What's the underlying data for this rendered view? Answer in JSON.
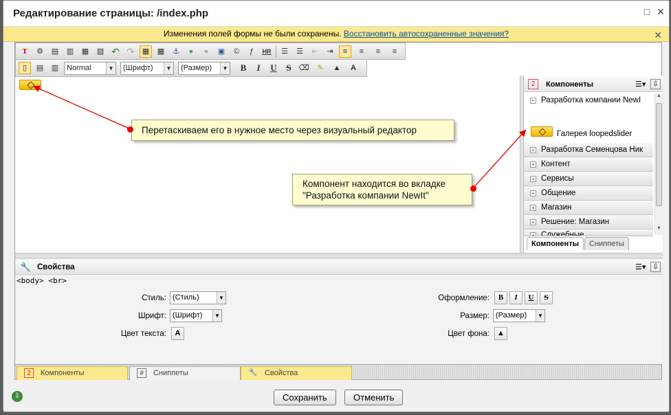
{
  "window": {
    "title": "Редактирование страницы: /index.php",
    "restore_icon": "□",
    "close_icon": "✕"
  },
  "warning": {
    "text": "Изменения полей формы не были сохранены.",
    "link": "Восстановить автосохраненные значения?",
    "close_icon": "✕"
  },
  "toolbar": {
    "style_select": "Normal",
    "font_select": "(Шрифт)",
    "size_select": "(Размер)",
    "hr_label": "HR",
    "bold": "B",
    "italic": "I",
    "underline": "U",
    "strike": "S"
  },
  "callouts": {
    "drag": "Перетаскиваем его в нужное место через визуальный редактор",
    "location_line1": "Компонент находится во вкладке",
    "location_line2": "\"Разработка компании NewIt\""
  },
  "components_panel": {
    "title": "Компоненты",
    "expanded_group": "Разработка компании NewI",
    "item": "Галерея loopedslider",
    "groups": [
      "Разработка Семенцова Ник",
      "Контент",
      "Сервисы",
      "Общение",
      "Магазин",
      "Решение: Магазин",
      "Служебные"
    ],
    "tabs": [
      "Компоненты",
      "Сниппеты"
    ]
  },
  "properties": {
    "title": "Свойства",
    "breadcrumb": [
      "<body>",
      "<br>"
    ],
    "style_label": "Стиль:",
    "style_value": "(Стиль)",
    "font_label": "Шрифт:",
    "font_value": "(Шрифт)",
    "text_color_label": "Цвет текста:",
    "format_label": "Оформление:",
    "size_label": "Размер:",
    "size_value": "(Размер)",
    "bg_color_label": "Цвет фона:"
  },
  "bottom_tabs": [
    "Компоненты",
    "Сниппеты",
    "Свойства"
  ],
  "footer": {
    "save": "Сохранить",
    "cancel": "Отменить"
  },
  "colors": {
    "warning_bg": "#fbe98e",
    "callout_bg": "#fffccf",
    "arrow": "#e00000",
    "component_badge": "#f2b600"
  }
}
